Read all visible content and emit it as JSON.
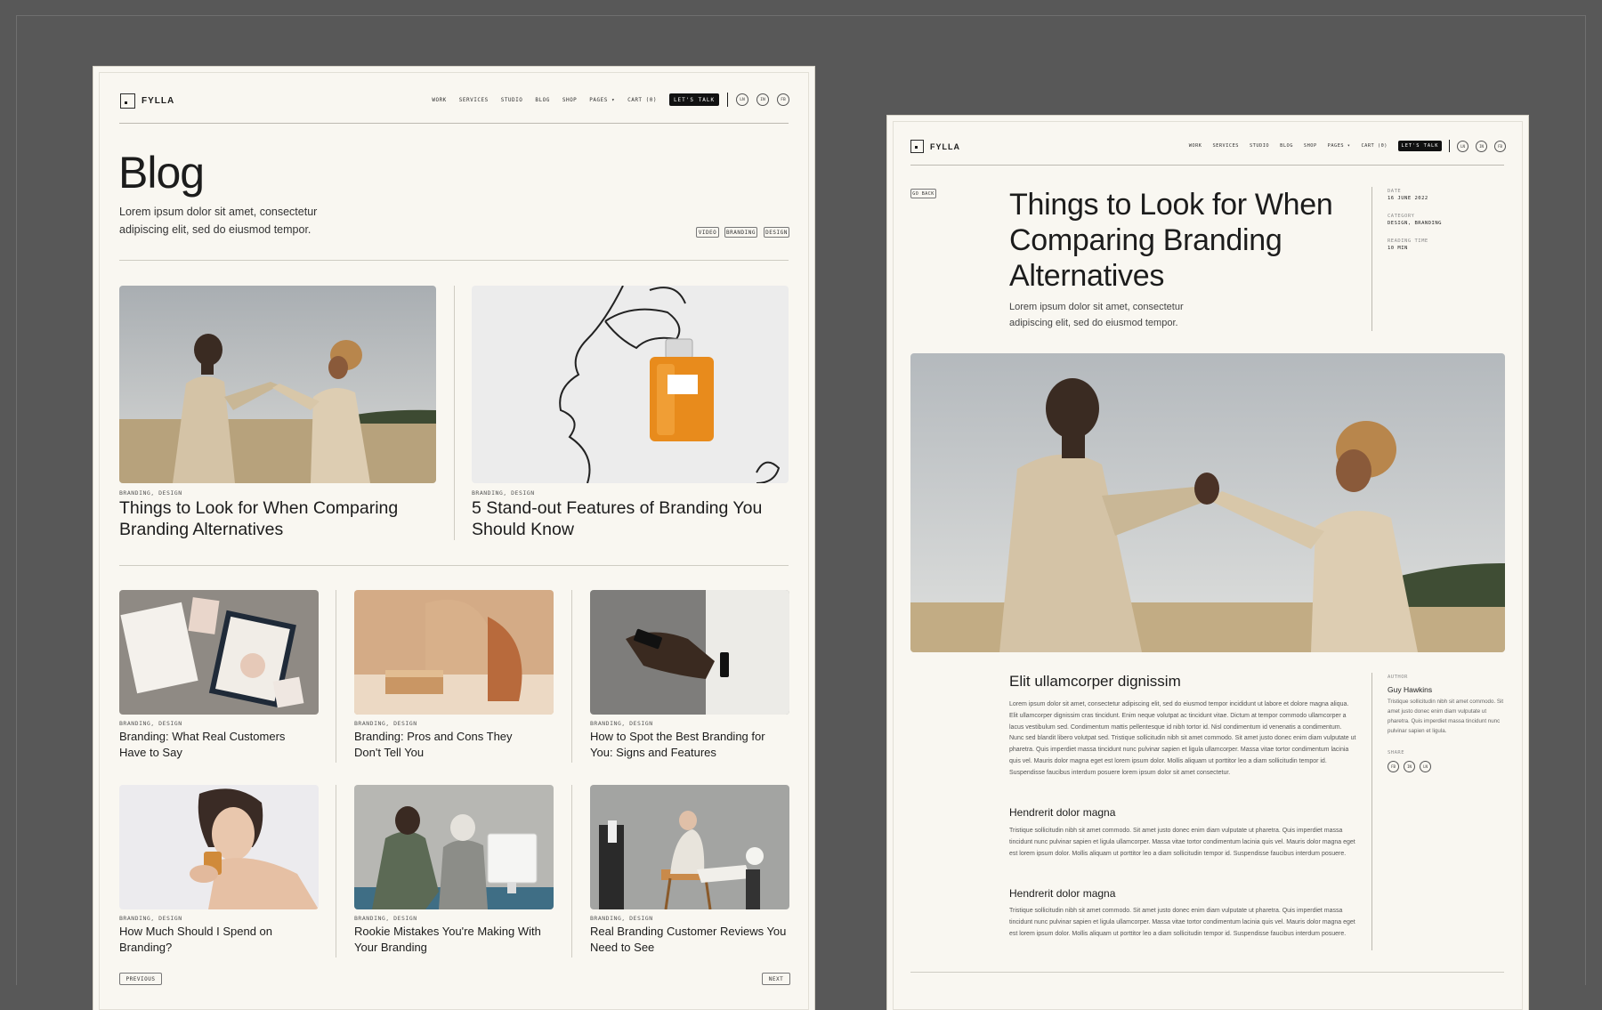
{
  "colors": {
    "background": "#585858",
    "page": "#f9f7f1",
    "ink": "#1c1c1c",
    "cta_bg": "#111111"
  },
  "brand": {
    "name": "FYLLA"
  },
  "nav": {
    "items": [
      "WORK",
      "SERVICES",
      "STUDIO",
      "BLOG",
      "SHOP",
      "PAGES ▾",
      "CART (0)"
    ],
    "cta": "LET'S TALK",
    "social": [
      "LN",
      "IN",
      "FB"
    ]
  },
  "blog_page": {
    "title": "Blog",
    "intro": "Lorem ipsum dolor sit amet, consectetur adipiscing elit, sed do eiusmod tempor.",
    "filters": [
      "VIDEO",
      "BRANDING",
      "DESIGN"
    ],
    "featured": [
      {
        "category": "BRANDING, DESIGN",
        "title": "Things to Look for When Comparing Branding Alternatives",
        "image": "couple-field-photo"
      },
      {
        "category": "BRANDING, DESIGN",
        "title": "5 Stand-out Features of Branding You Should Know",
        "image": "perfume-line-art-photo"
      }
    ],
    "posts": [
      {
        "category": "BRANDING, DESIGN",
        "title": "Branding: What Real Customers Have to Say",
        "image": "stationery-photo"
      },
      {
        "category": "BRANDING, DESIGN",
        "title": "Branding: Pros and Cons They Don't Tell You",
        "image": "shapes-photo"
      },
      {
        "category": "BRANDING, DESIGN",
        "title": "How to Spot the Best Branding for You: Signs and Features",
        "image": "phone-hand-photo"
      },
      {
        "category": "BRANDING, DESIGN",
        "title": "How Much Should I Spend on Branding?",
        "image": "woman-perfume-photo"
      },
      {
        "category": "BRANDING, DESIGN",
        "title": "Rookie Mistakes You're Making With Your Branding",
        "image": "office-photo"
      },
      {
        "category": "BRANDING, DESIGN",
        "title": "Real Branding Customer Reviews You Need to See",
        "image": "reading-chair-photo"
      }
    ],
    "pagination": {
      "previous": "PREVIOUS",
      "next": "NEXT"
    }
  },
  "article_page": {
    "back": "GO BACK",
    "title": "Things to Look for When Comparing Branding Alternatives",
    "intro": "Lorem ipsum dolor sit amet, consectetur adipiscing elit, sed do eiusmod tempor.",
    "meta": [
      {
        "label": "DATE",
        "value": "16 JUNE 2022"
      },
      {
        "label": "CATEGORY",
        "value": "DESIGN, BRANDING"
      },
      {
        "label": "READING TIME",
        "value": "10 MIN"
      }
    ],
    "sections": [
      {
        "heading": "Elit ullamcorper dignissim",
        "body": "Lorem ipsum dolor sit amet, consectetur adipiscing elit, sed do eiusmod tempor incididunt ut labore et dolore magna aliqua. Elit ullamcorper dignissim cras tincidunt. Enim neque volutpat ac tincidunt vitae. Dictum at tempor commodo ullamcorper a lacus vestibulum sed. Condimentum mattis pellentesque id nibh tortor id. Nisl condimentum id venenatis a condimentum. Nunc sed blandit libero volutpat sed. Tristique sollicitudin nibh sit amet commodo. Sit amet justo donec enim diam vulputate ut pharetra. Quis imperdiet massa tincidunt nunc pulvinar sapien et ligula ullamcorper. Massa vitae tortor condimentum lacinia quis vel. Mauris dolor magna eget est lorem ipsum dolor. Mollis aliquam ut porttitor leo a diam sollicitudin tempor id. Suspendisse faucibus interdum posuere lorem ipsum dolor sit amet consectetur."
      },
      {
        "heading": "Hendrerit dolor magna",
        "body": "Tristique sollicitudin nibh sit amet commodo. Sit amet justo donec enim diam vulputate ut pharetra. Quis imperdiet massa tincidunt nunc pulvinar sapien et ligula ullamcorper. Massa vitae tortor condimentum lacinia quis vel. Mauris dolor magna eget est lorem ipsum dolor. Mollis aliquam ut porttitor leo a diam sollicitudin tempor id. Suspendisse faucibus interdum posuere."
      },
      {
        "heading": "Hendrerit dolor magna",
        "body": "Tristique sollicitudin nibh sit amet commodo. Sit amet justo donec enim diam vulputate ut pharetra. Quis imperdiet massa tincidunt nunc pulvinar sapien et ligula ullamcorper. Massa vitae tortor condimentum lacinia quis vel. Mauris dolor magna eget est lorem ipsum dolor. Mollis aliquam ut porttitor leo a diam sollicitudin tempor id. Suspendisse faucibus interdum posuere."
      }
    ],
    "author": {
      "label": "AUTHOR",
      "name": "Guy Hawkins",
      "bio": "Tristique sollicitudin nibh sit amet commodo. Sit amet justo donec enim diam vulputate ut pharetra. Quis imperdiet massa tincidunt nunc pulvinar sapien et ligula."
    },
    "share": {
      "label": "SHARE",
      "icons": [
        "FB",
        "IN",
        "LN"
      ]
    }
  }
}
